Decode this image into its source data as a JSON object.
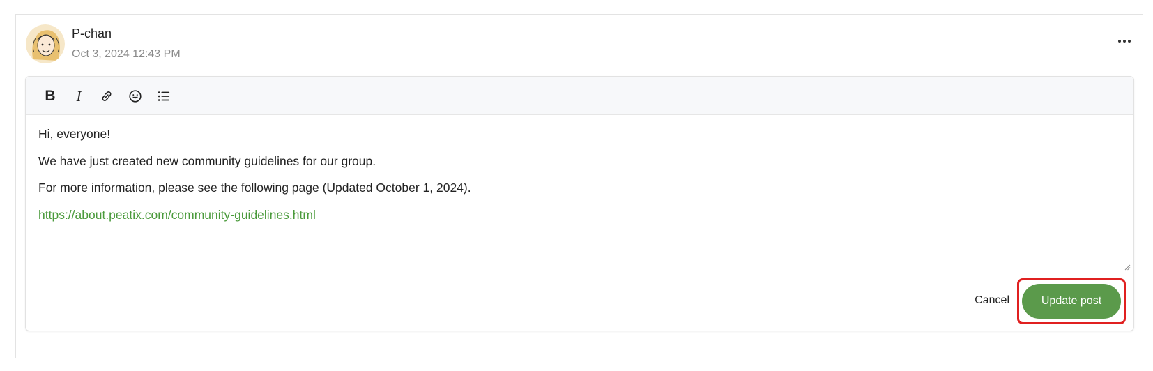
{
  "post": {
    "author": "P-chan",
    "timestamp": "Oct 3, 2024 12:43 PM",
    "avatar_icon": "avatar-illustration",
    "more_icon": "ellipsis-icon"
  },
  "toolbar": {
    "bold_label": "B",
    "italic_label": "I",
    "link_icon": "link-icon",
    "emoji_icon": "emoji-icon",
    "list_icon": "bulleted-list-icon"
  },
  "editor": {
    "lines": [
      "Hi, everyone!",
      "We have just created new community guidelines for our group.",
      "For more information, please see the following page (Updated October 1, 2024)."
    ],
    "link_text": "https://about.peatix.com/community-guidelines.html"
  },
  "actions": {
    "cancel_label": "Cancel",
    "update_label": "Update post"
  },
  "colors": {
    "accent": "#5b9a4b",
    "link": "#4a9a3b",
    "highlight": "#e02020"
  }
}
